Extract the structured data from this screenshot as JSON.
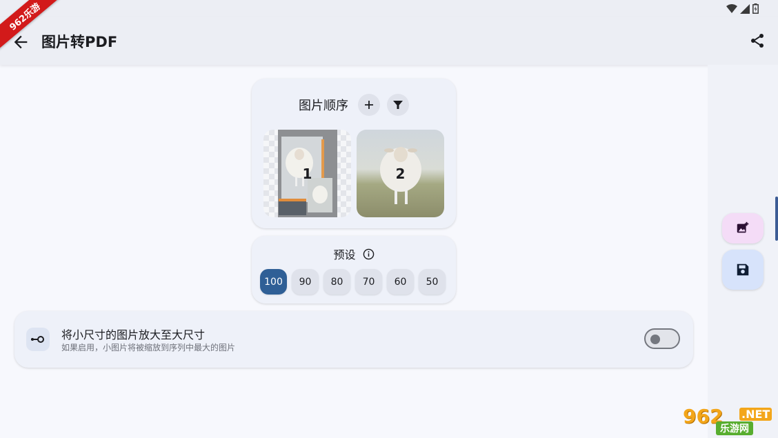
{
  "header": {
    "title": "图片转PDF",
    "badge": "962乐游"
  },
  "order": {
    "title": "图片顺序",
    "thumbnails": [
      {
        "number": "1"
      },
      {
        "number": "2"
      }
    ]
  },
  "presets": {
    "title": "预设",
    "options": [
      "100",
      "90",
      "80",
      "70",
      "60",
      "50"
    ],
    "selected": "100"
  },
  "setting": {
    "title": "将小尺寸的图片放大至大尺寸",
    "subtitle": "如果启用，小图片将被缩放到序列中最大的图片",
    "enabled": false
  },
  "watermark": {
    "top": "962",
    "net": ".NET",
    "bottom": "乐游网"
  },
  "colors": {
    "accent": "#2f5f96",
    "badge": "#d21a1a"
  }
}
